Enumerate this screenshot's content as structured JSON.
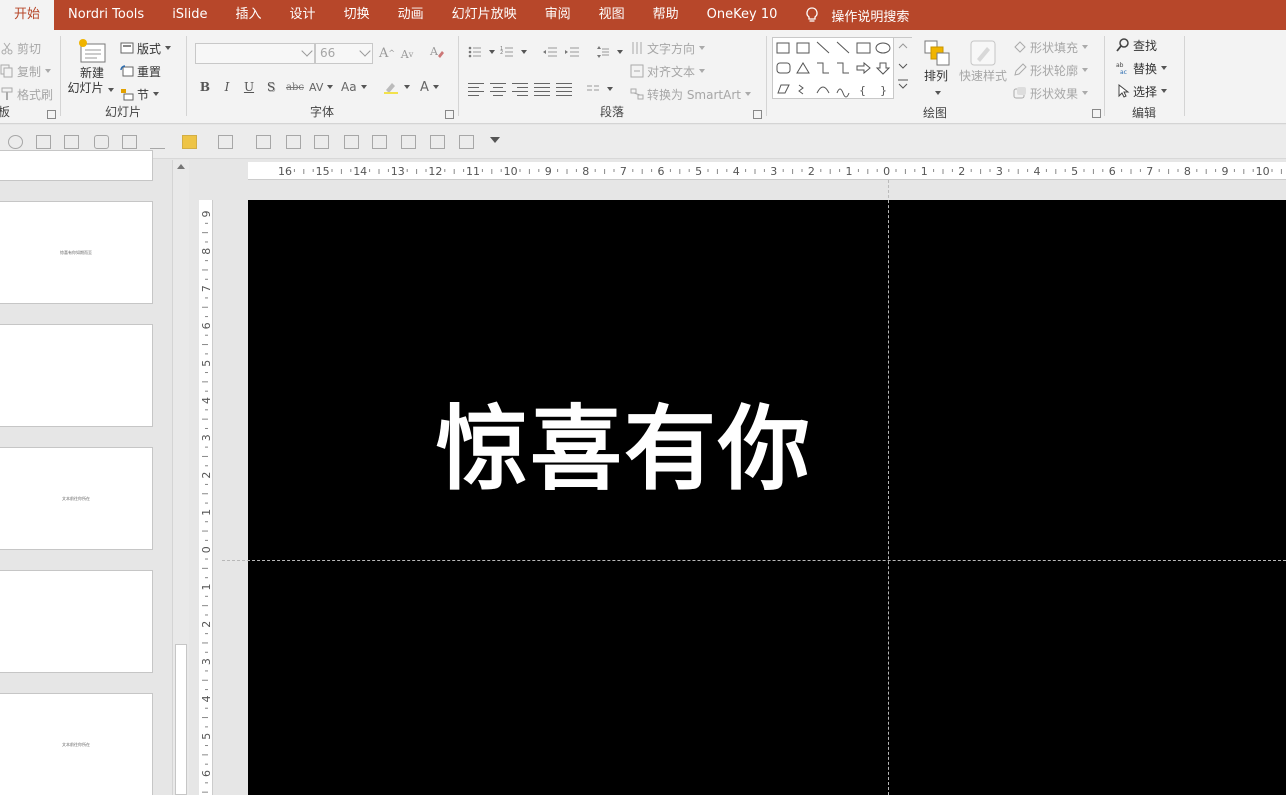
{
  "tabs": {
    "items": [
      "开始",
      "Nordri Tools",
      "iSlide",
      "插入",
      "设计",
      "切换",
      "动画",
      "幻灯片放映",
      "审阅",
      "视图",
      "帮助",
      "OneKey 10"
    ],
    "active": "开始",
    "tell_me": "操作说明搜索"
  },
  "ribbon": {
    "clipboard": {
      "cut": "剪切",
      "copy": "复制",
      "format_painter": "格式刷",
      "label": "板"
    },
    "slides": {
      "new_slide_line1": "新建",
      "new_slide_line2": "幻灯片",
      "layout": "版式",
      "reset": "重置",
      "section": "节",
      "label": "幻灯片"
    },
    "font": {
      "font_size": "66",
      "label": "字体",
      "bold": "B",
      "italic": "I",
      "underline": "U",
      "shadow": "S",
      "strike": "abc",
      "spacing": "AV",
      "case": "Aa",
      "grow": "A",
      "shrink": "A",
      "color": "A"
    },
    "paragraph": {
      "text_direction": "文字方向",
      "align_text": "对齐文本",
      "smartart": "转换为 SmartArt",
      "label": "段落"
    },
    "drawing": {
      "arrange": "排列",
      "quick_styles": "快速样式",
      "shape_fill": "形状填充",
      "shape_outline": "形状轮廓",
      "shape_effects": "形状效果",
      "label": "绘图"
    },
    "editing": {
      "find": "查找",
      "replace": "替换",
      "select": "选择",
      "label": "编辑"
    }
  },
  "colors": {
    "accent": "#b7472a",
    "ribbon_bg": "#f3f3f3",
    "slide_bg": "#000000"
  },
  "thumbnails": [
    {
      "title": ""
    },
    {
      "title": "惊喜有你如期而至"
    },
    {
      "title": ""
    },
    {
      "title": "文本前往你所在"
    },
    {
      "title": ""
    },
    {
      "title": "文本前往你所在"
    }
  ],
  "ruler": {
    "h": [
      "16",
      "15",
      "14",
      "13",
      "12",
      "11",
      "10",
      "9",
      "8",
      "7",
      "6",
      "5",
      "4",
      "3",
      "2",
      "1",
      "0",
      "1",
      "2",
      "3",
      "4",
      "5",
      "6",
      "7",
      "8",
      "9",
      "10"
    ],
    "v": [
      "9",
      "8",
      "7",
      "6",
      "5",
      "4",
      "3",
      "2",
      "1",
      "0",
      "1",
      "2",
      "3",
      "4",
      "5",
      "6"
    ]
  },
  "slide": {
    "title": "惊喜有你"
  }
}
